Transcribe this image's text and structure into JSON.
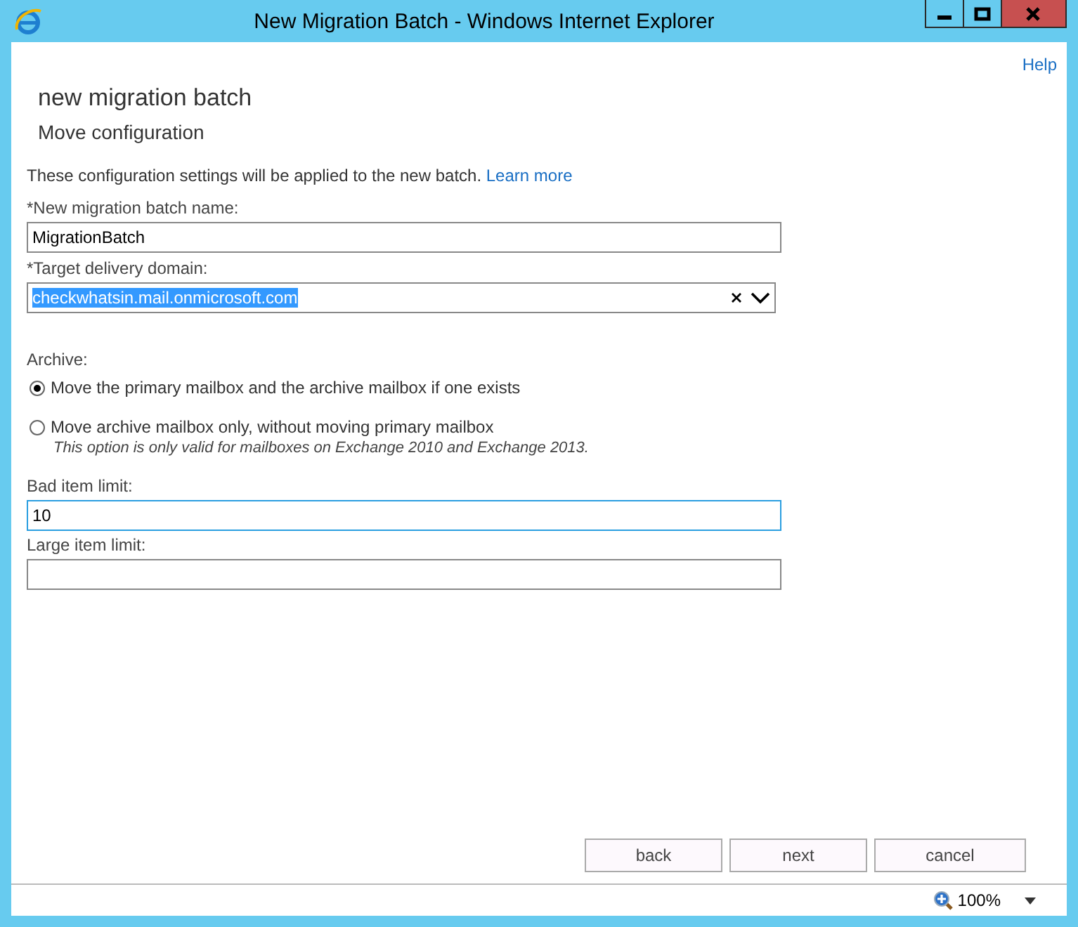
{
  "window": {
    "title": "New Migration Batch - Windows Internet Explorer"
  },
  "help_link": "Help",
  "heading": "new migration batch",
  "subheading": "Move configuration",
  "intro": {
    "text": "These configuration settings will be applied to the new batch.",
    "link": "Learn more"
  },
  "fields": [
    {
      "kind": "text",
      "label": "*New migration batch name:",
      "value": "MigrationBatch",
      "focused": false
    },
    {
      "kind": "combo",
      "label": "*Target delivery domain:",
      "value": "checkwhatsin.mail.onmicrosoft.com",
      "text_selected": true,
      "focused": false
    }
  ],
  "archive": {
    "label": "Archive:",
    "options": [
      {
        "label": "Move the primary mailbox and the archive mailbox if one exists",
        "selected": true
      },
      {
        "label": "Move archive mailbox only, without moving primary mailbox",
        "note": "This option is only valid for mailboxes on Exchange 2010 and Exchange 2013.",
        "selected": false
      }
    ]
  },
  "limits": [
    {
      "label": "Bad item limit:",
      "value": "10",
      "focused": true
    },
    {
      "label": "Large item limit:",
      "focused": false
    }
  ],
  "buttons": [
    "back",
    "next",
    "cancel"
  ],
  "status_bar": {
    "zoom": "100%"
  }
}
